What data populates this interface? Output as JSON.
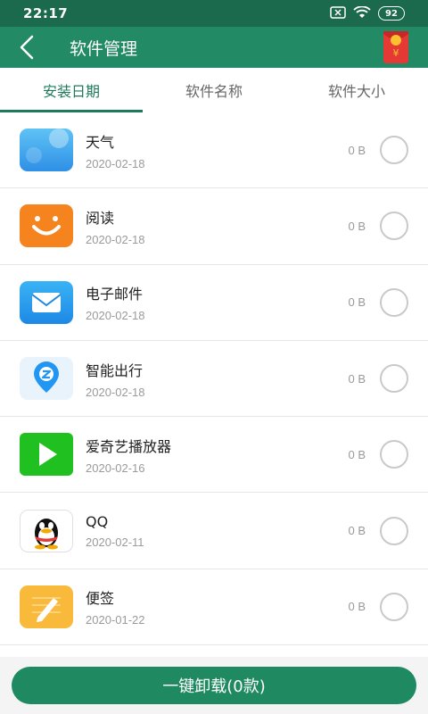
{
  "status_bar": {
    "time": "22:17",
    "battery": "92"
  },
  "app_bar": {
    "title": "软件管理"
  },
  "tabs": [
    {
      "label": "安装日期",
      "active": true
    },
    {
      "label": "软件名称",
      "active": false
    },
    {
      "label": "软件大小",
      "active": false
    }
  ],
  "apps": [
    {
      "name": "天气",
      "date": "2020-02-18",
      "size": "0 B",
      "icon": "weather-icon"
    },
    {
      "name": "阅读",
      "date": "2020-02-18",
      "size": "0 B",
      "icon": "reader-icon"
    },
    {
      "name": "电子邮件",
      "date": "2020-02-18",
      "size": "0 B",
      "icon": "email-icon"
    },
    {
      "name": "智能出行",
      "date": "2020-02-18",
      "size": "0 B",
      "icon": "smart-travel-icon"
    },
    {
      "name": "爱奇艺播放器",
      "date": "2020-02-16",
      "size": "0 B",
      "icon": "iqiyi-icon"
    },
    {
      "name": "QQ",
      "date": "2020-02-11",
      "size": "0 B",
      "icon": "qq-icon"
    },
    {
      "name": "便签",
      "date": "2020-01-22",
      "size": "0 B",
      "icon": "notes-icon"
    }
  ],
  "footer": {
    "uninstall_label": "一键卸载(0款)"
  },
  "colors": {
    "primary": "#238a66",
    "status_bar": "#1c6a4e",
    "accent": "#1f7a5a"
  }
}
